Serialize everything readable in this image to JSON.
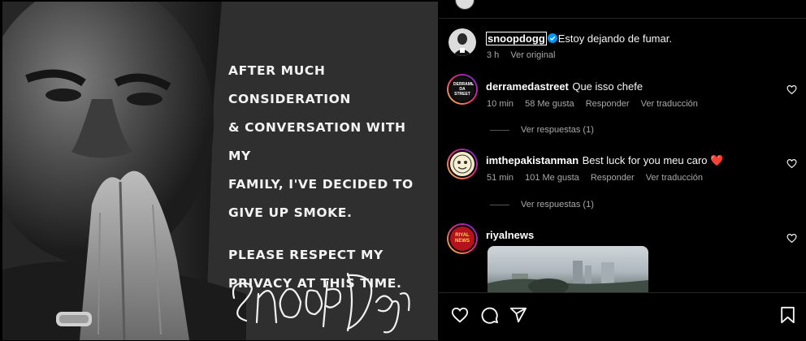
{
  "post_image": {
    "quote_lines": [
      "After much consideration",
      "& conversation with my",
      "family, I've decided to",
      "give up smoke."
    ],
    "quote_lines_2": [
      "Please respect my",
      "privacy at this time."
    ]
  },
  "caption": {
    "username": "snoopdogg",
    "text": "Estoy dejando de fumar.",
    "time": "3 h",
    "see_original": "Ver original"
  },
  "comments": [
    {
      "username": "derramedastreet",
      "text": "Que isso chefe",
      "time": "10 min",
      "likes": "58 Me gusta",
      "reply": "Responder",
      "translate": "Ver traducción",
      "view_replies": "Ver respuestas (1)",
      "avatar_text": "DERRAME DA STREET"
    },
    {
      "username": "imthepakistanman",
      "text": "Best luck for you meu caro ❤️",
      "time": "51 min",
      "likes": "101 Me gusta",
      "reply": "Responder",
      "translate": "Ver traducción",
      "view_replies": "Ver respuestas (1)"
    },
    {
      "username": "riyalnews",
      "text": "",
      "avatar_text": "RIYAL NEWS"
    }
  ],
  "icons": {
    "like": "heart-icon",
    "comment": "comment-icon",
    "share": "share-icon",
    "save": "bookmark-icon",
    "verified": "verified-badge-icon"
  },
  "colors": {
    "background": "#000000",
    "secondary_text": "#a8a8a8",
    "verified_blue": "#0095f6",
    "heart_red": "#ed4956"
  }
}
